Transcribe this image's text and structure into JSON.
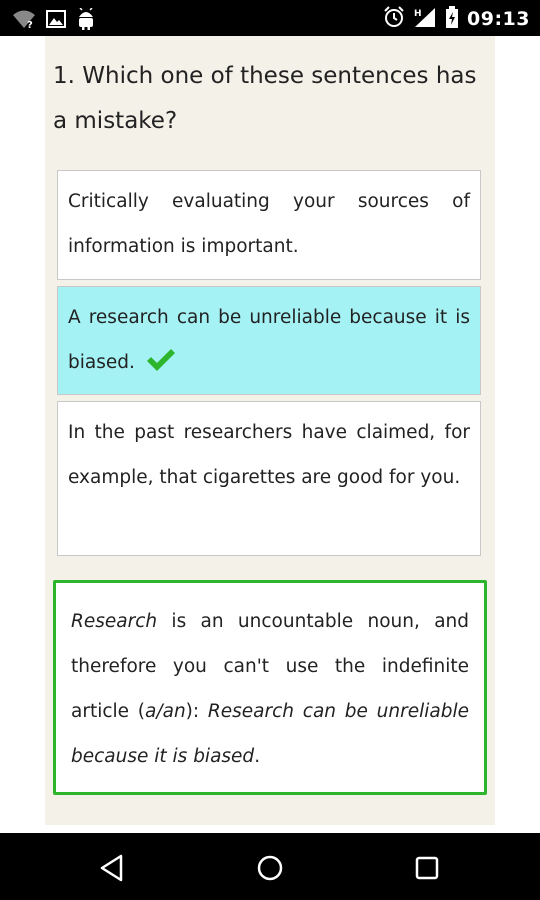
{
  "status_bar": {
    "time": "09:13",
    "icons": [
      "wifi-question-icon",
      "image-icon",
      "android-icon",
      "alarm-icon",
      "signal-h-icon",
      "battery-charging-icon"
    ]
  },
  "question": {
    "text": "1. Which one of these sentences has a mistake?"
  },
  "options": [
    {
      "text": "Critically evaluating your sources of information is important.",
      "selected": false
    },
    {
      "text": "A research can be unreliable because it is biased.",
      "selected": true,
      "correct": true
    },
    {
      "text": "In the past researchers have claimed, for example, that cigarettes are good for you.",
      "selected": false
    }
  ],
  "feedback": {
    "part1": "Research",
    "part2": " is an uncountable noun, and therefore you can't use the indefinite article (",
    "part3": "a/an",
    "part4": "): ",
    "part5": "Research can be unreliable because it is biased",
    "part6": "."
  },
  "colors": {
    "selected_bg": "#a5f2f5",
    "correct_green": "#2db52d",
    "content_bg": "#f4f1e8"
  },
  "nav_bar": {
    "icons": [
      "back-icon",
      "home-icon",
      "recents-icon"
    ]
  }
}
